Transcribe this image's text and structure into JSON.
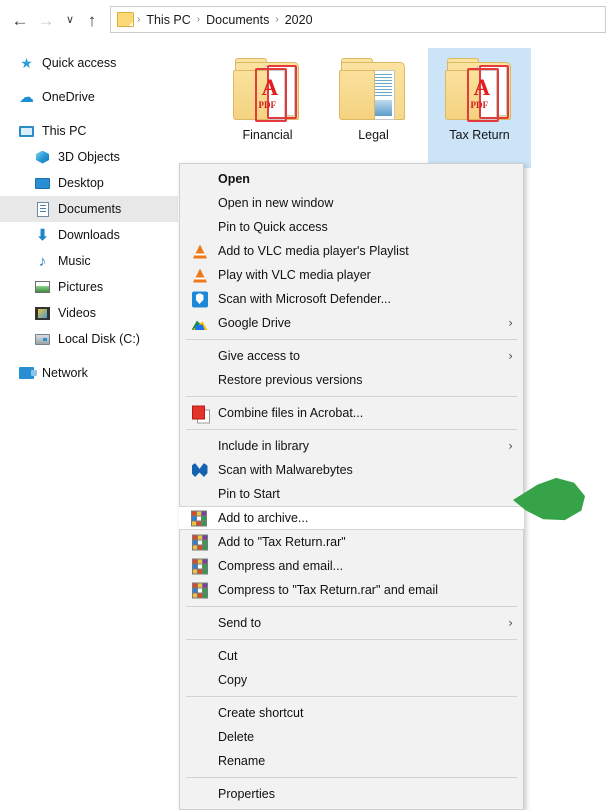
{
  "window": {
    "nav": {
      "back_icon": "arrow-left-icon",
      "back_label": "←",
      "forward_icon": "arrow-right-icon",
      "forward_label": "→",
      "forward_disabled": true,
      "recent_icon": "chevron-down-icon",
      "recent_label": "∨",
      "up_icon": "arrow-up-icon",
      "up_label": "↑"
    },
    "address": {
      "folder_icon": "folder-icon",
      "crumbs": [
        "This PC",
        "Documents",
        "2020"
      ],
      "separator": "›"
    }
  },
  "sidebar": {
    "items": [
      {
        "label": "Quick access",
        "icon": "star-icon",
        "level": 0,
        "selected": false
      },
      {
        "label": "OneDrive",
        "icon": "cloud-icon",
        "level": 0,
        "selected": false
      },
      {
        "label": "This PC",
        "icon": "monitor-icon",
        "level": 0,
        "selected": false
      },
      {
        "label": "3D Objects",
        "icon": "cube-icon",
        "level": 1,
        "selected": false
      },
      {
        "label": "Desktop",
        "icon": "desktop-icon",
        "level": 1,
        "selected": false
      },
      {
        "label": "Documents",
        "icon": "document-icon",
        "level": 1,
        "selected": true
      },
      {
        "label": "Downloads",
        "icon": "download-icon",
        "level": 1,
        "selected": false
      },
      {
        "label": "Music",
        "icon": "music-note-icon",
        "level": 1,
        "selected": false
      },
      {
        "label": "Pictures",
        "icon": "picture-icon",
        "level": 1,
        "selected": false
      },
      {
        "label": "Videos",
        "icon": "video-icon",
        "level": 1,
        "selected": false
      },
      {
        "label": "Local Disk (C:)",
        "icon": "disk-drive-icon",
        "level": 1,
        "selected": false
      },
      {
        "label": "Network",
        "icon": "network-icon",
        "level": 0,
        "selected": false
      }
    ]
  },
  "files": {
    "items": [
      {
        "label": "Financial",
        "kind": "pdf-folder-icon",
        "selected": false
      },
      {
        "label": "Legal",
        "kind": "doc-folder-icon",
        "selected": false
      },
      {
        "label": "Tax Return",
        "kind": "pdf-folder-icon",
        "selected": true
      }
    ]
  },
  "context_menu": {
    "items": [
      {
        "label": "Open",
        "icon": null,
        "bold": true,
        "submenu": false,
        "highlighted": false,
        "separator_after": false
      },
      {
        "label": "Open in new window",
        "icon": null,
        "bold": false,
        "submenu": false,
        "highlighted": false,
        "separator_after": false
      },
      {
        "label": "Pin to Quick access",
        "icon": null,
        "bold": false,
        "submenu": false,
        "highlighted": false,
        "separator_after": false
      },
      {
        "label": "Add to VLC media player's Playlist",
        "icon": "vlc-cone-icon",
        "bold": false,
        "submenu": false,
        "highlighted": false,
        "separator_after": false
      },
      {
        "label": "Play with VLC media player",
        "icon": "vlc-cone-icon",
        "bold": false,
        "submenu": false,
        "highlighted": false,
        "separator_after": false
      },
      {
        "label": "Scan with Microsoft Defender...",
        "icon": "defender-shield-icon",
        "bold": false,
        "submenu": false,
        "highlighted": false,
        "separator_after": false
      },
      {
        "label": "Google Drive",
        "icon": "google-drive-icon",
        "bold": false,
        "submenu": true,
        "highlighted": false,
        "separator_after": true
      },
      {
        "label": "Give access to",
        "icon": null,
        "bold": false,
        "submenu": true,
        "highlighted": false,
        "separator_after": false
      },
      {
        "label": "Restore previous versions",
        "icon": null,
        "bold": false,
        "submenu": false,
        "highlighted": false,
        "separator_after": true
      },
      {
        "label": "Combine files in Acrobat...",
        "icon": "acrobat-icon",
        "bold": false,
        "submenu": false,
        "highlighted": false,
        "separator_after": true
      },
      {
        "label": "Include in library",
        "icon": null,
        "bold": false,
        "submenu": true,
        "highlighted": false,
        "separator_after": false
      },
      {
        "label": "Scan with Malwarebytes",
        "icon": "malwarebytes-icon",
        "bold": false,
        "submenu": false,
        "highlighted": false,
        "separator_after": false
      },
      {
        "label": "Pin to Start",
        "icon": null,
        "bold": false,
        "submenu": false,
        "highlighted": false,
        "separator_after": false
      },
      {
        "label": "Add to archive...",
        "icon": "winrar-icon",
        "bold": false,
        "submenu": false,
        "highlighted": true,
        "separator_after": false
      },
      {
        "label": "Add to \"Tax Return.rar\"",
        "icon": "winrar-icon",
        "bold": false,
        "submenu": false,
        "highlighted": false,
        "separator_after": false
      },
      {
        "label": "Compress and email...",
        "icon": "winrar-icon",
        "bold": false,
        "submenu": false,
        "highlighted": false,
        "separator_after": false
      },
      {
        "label": "Compress to \"Tax Return.rar\" and email",
        "icon": "winrar-icon",
        "bold": false,
        "submenu": false,
        "highlighted": false,
        "separator_after": true
      },
      {
        "label": "Send to",
        "icon": null,
        "bold": false,
        "submenu": true,
        "highlighted": false,
        "separator_after": true
      },
      {
        "label": "Cut",
        "icon": null,
        "bold": false,
        "submenu": false,
        "highlighted": false,
        "separator_after": false
      },
      {
        "label": "Copy",
        "icon": null,
        "bold": false,
        "submenu": false,
        "highlighted": false,
        "separator_after": true
      },
      {
        "label": "Create shortcut",
        "icon": null,
        "bold": false,
        "submenu": false,
        "highlighted": false,
        "separator_after": false
      },
      {
        "label": "Delete",
        "icon": null,
        "bold": false,
        "submenu": false,
        "highlighted": false,
        "separator_after": false
      },
      {
        "label": "Rename",
        "icon": null,
        "bold": false,
        "submenu": false,
        "highlighted": false,
        "separator_after": true
      },
      {
        "label": "Properties",
        "icon": null,
        "bold": false,
        "submenu": false,
        "highlighted": false,
        "separator_after": false
      }
    ],
    "submenu_chevron": "›"
  },
  "annotation": {
    "pointer_icon": "green-arrow-pointer",
    "color": "#36a349",
    "points_at": "Add to archive..."
  },
  "colors": {
    "selection_blue": "#cce4f7",
    "sidebar_selection": "#e8e8e8",
    "menu_background": "#f2f2f2",
    "annotation_green": "#36a349",
    "folder_yellow": "#fbe3a0",
    "pdf_red": "#e33b3b"
  }
}
